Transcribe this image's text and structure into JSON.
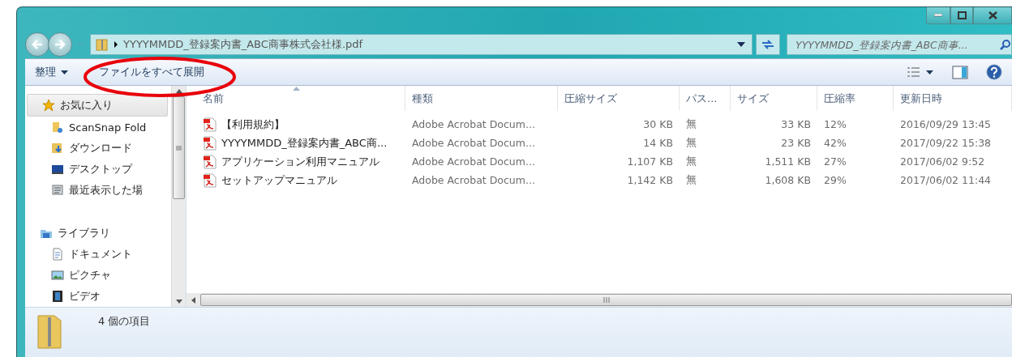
{
  "address": {
    "path": "YYYYMMDD_登録案内書_ABC商事株式会社様.pdf"
  },
  "search": {
    "placeholder": "YYYYMMDD_登録案内書_ABC商事..."
  },
  "toolbar": {
    "items": [
      {
        "label": "整理",
        "kind": "menu"
      },
      {
        "label": "ファイルをすべて展開",
        "kind": "plain"
      }
    ]
  },
  "sidebar": {
    "groups": [
      {
        "label": "お気に入り",
        "kind": "star",
        "selected": true,
        "children": [
          {
            "label": "ScanSnap Fold",
            "kind": "scansnap",
            "selected": false
          },
          {
            "label": "ダウンロード",
            "kind": "download",
            "selected": false
          },
          {
            "label": "デスクトップ",
            "kind": "desktop",
            "selected": false
          },
          {
            "label": "最近表示した場",
            "kind": "recent",
            "selected": false
          }
        ]
      },
      {
        "label": "ライブラリ",
        "kind": "library",
        "selected": false,
        "children": [
          {
            "label": "ドキュメント",
            "kind": "document",
            "selected": false
          },
          {
            "label": "ピクチャ",
            "kind": "picture",
            "selected": false
          },
          {
            "label": "ビデオ",
            "kind": "video",
            "selected": false
          }
        ]
      }
    ]
  },
  "table": {
    "columns": [
      {
        "label": "名前",
        "sorted": true
      },
      {
        "label": "種類",
        "sorted": false
      },
      {
        "label": "圧縮サイズ",
        "sorted": false
      },
      {
        "label": "パス...",
        "sorted": false
      },
      {
        "label": "サイズ",
        "sorted": false
      },
      {
        "label": "圧縮率",
        "sorted": false
      },
      {
        "label": "更新日時",
        "sorted": false
      }
    ],
    "rows": [
      {
        "name": "【利用規約】",
        "type": "Adobe Acrobat Docum...",
        "packed": "30 KB",
        "password": "無",
        "size": "33 KB",
        "ratio": "12%",
        "modified": "2016/09/29 13:45"
      },
      {
        "name": "YYYYMMDD_登録案内書_ABC商...",
        "type": "Adobe Acrobat Docum...",
        "packed": "14 KB",
        "password": "無",
        "size": "23 KB",
        "ratio": "42%",
        "modified": "2017/09/22 15:38"
      },
      {
        "name": "アプリケーション利用マニュアル",
        "type": "Adobe Acrobat Docum...",
        "packed": "1,107 KB",
        "password": "無",
        "size": "1,511 KB",
        "ratio": "27%",
        "modified": "2017/06/02 9:52"
      },
      {
        "name": "セットアップマニュアル",
        "type": "Adobe Acrobat Docum...",
        "packed": "1,142 KB",
        "password": "無",
        "size": "1,608 KB",
        "ratio": "29%",
        "modified": "2017/06/02 11:44"
      }
    ]
  },
  "status": {
    "text": "4 個の項目"
  }
}
